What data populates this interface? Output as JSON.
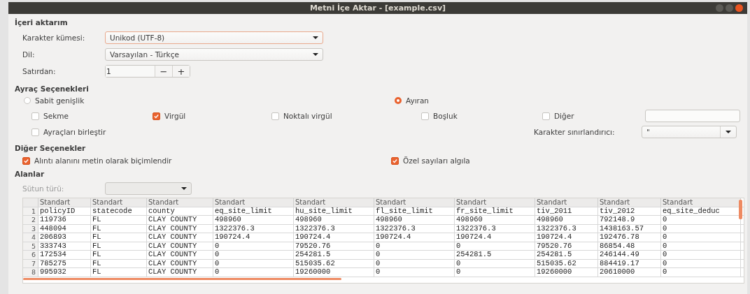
{
  "window": {
    "title": "Metni İçe Aktar - [example.csv]"
  },
  "import": {
    "heading": "İçeri aktarım",
    "charset": {
      "label": "Karakter kümesi:",
      "value": "Unikod (UTF-8)"
    },
    "language": {
      "label": "Dil:",
      "value": "Varsayılan - Türkçe"
    },
    "from_row": {
      "label": "Satırdan:",
      "value": "1",
      "decrement": "−",
      "increment": "+"
    }
  },
  "separator_options": {
    "heading": "Ayraç Seçenekleri",
    "modes": [
      {
        "label": "Sabit genişlik",
        "selected": false
      },
      {
        "label": "Ayıran",
        "selected": true
      }
    ],
    "separators": [
      {
        "label": "Sekme",
        "checked": false
      },
      {
        "label": "Virgül",
        "checked": true
      },
      {
        "label": "Noktalı virgül",
        "checked": false
      },
      {
        "label": "Boşluk",
        "checked": false
      },
      {
        "label": "Diğer",
        "checked": false
      }
    ],
    "merge": {
      "label": "Ayraçları birleştir",
      "checked": false
    },
    "text_delimiter": {
      "label": "Karakter sınırlandırıcı:",
      "value": "\""
    }
  },
  "other_options": {
    "heading": "Diğer Seçenekler",
    "options": [
      {
        "label": "Alıntı alanını metin olarak biçimlendir",
        "checked": true
      },
      {
        "label": "Özel sayıları algıla",
        "checked": true
      }
    ]
  },
  "fields": {
    "heading": "Alanlar",
    "column_type": {
      "label": "Sütun türü:",
      "disabled": true
    },
    "table": {
      "column_types": [
        "Standart",
        "Standart",
        "Standart",
        "Standart",
        "Standart",
        "Standart",
        "Standart",
        "Standart",
        "Standart",
        "Standart"
      ],
      "rows": [
        {
          "number": "1",
          "cells": [
            "policyID",
            "statecode",
            "county",
            "eq_site_limit",
            "hu_site_limit",
            "fl_site_limit",
            "fr_site_limit",
            "tiv_2011",
            "tiv_2012",
            "eq_site_deduc"
          ]
        },
        {
          "number": "2",
          "cells": [
            "119736",
            "FL",
            "CLAY COUNTY",
            "498960",
            "498960",
            "498960",
            "498960",
            "498960",
            "792148.9",
            "0"
          ]
        },
        {
          "number": "3",
          "cells": [
            "448094",
            "FL",
            "CLAY COUNTY",
            "1322376.3",
            "1322376.3",
            "1322376.3",
            "1322376.3",
            "1322376.3",
            "1438163.57",
            "0"
          ]
        },
        {
          "number": "4",
          "cells": [
            "206893",
            "FL",
            "CLAY COUNTY",
            "190724.4",
            "190724.4",
            "190724.4",
            "190724.4",
            "190724.4",
            "192476.78",
            "0"
          ]
        },
        {
          "number": "5",
          "cells": [
            "333743",
            "FL",
            "CLAY COUNTY",
            "0",
            "79520.76",
            "0",
            "0",
            "79520.76",
            "86854.48",
            "0"
          ]
        },
        {
          "number": "6",
          "cells": [
            "172534",
            "FL",
            "CLAY COUNTY",
            "0",
            "254281.5",
            "0",
            "254281.5",
            "254281.5",
            "246144.49",
            "0"
          ]
        },
        {
          "number": "7",
          "cells": [
            "785275",
            "FL",
            "CLAY COUNTY",
            "0",
            "515035.62",
            "0",
            "0",
            "515035.62",
            "884419.17",
            "0"
          ]
        },
        {
          "number": "8",
          "cells": [
            "995932",
            "FL",
            "CLAY COUNTY",
            "0",
            "19260000",
            "0",
            "0",
            "19260000",
            "20610000",
            "0"
          ]
        }
      ]
    }
  }
}
